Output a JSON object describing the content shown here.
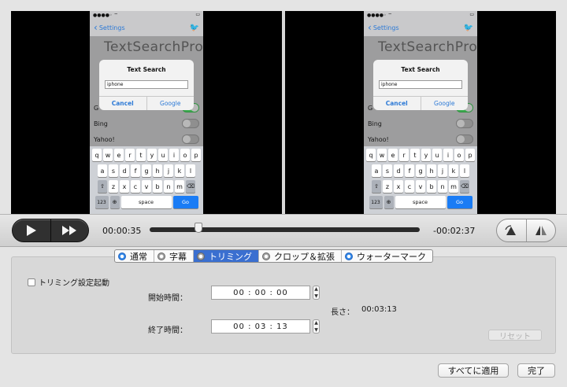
{
  "phone": {
    "nav_back": "Settings",
    "app_title": "TextSearchPro",
    "alert_title": "Text Search",
    "alert_input_value": "iphone",
    "alert_cancel": "Cancel",
    "alert_google": "Google",
    "row_g": "G",
    "row_bing": "Bing",
    "row_yahoo": "Yahoo!",
    "keys_row1": [
      "q",
      "w",
      "e",
      "r",
      "t",
      "y",
      "u",
      "i",
      "o",
      "p"
    ],
    "keys_row2": [
      "a",
      "s",
      "d",
      "f",
      "g",
      "h",
      "j",
      "k",
      "l"
    ],
    "keys_row3": [
      "z",
      "x",
      "c",
      "v",
      "b",
      "n",
      "m"
    ],
    "key_num": "123",
    "key_space": "space",
    "key_go": "Go"
  },
  "transport": {
    "current_time": "00:00:35",
    "remaining_time": "-00:02:37",
    "playback_position": 0.18
  },
  "tabs": [
    {
      "label": "通常",
      "state": "blue"
    },
    {
      "label": "字幕",
      "state": "gray"
    },
    {
      "label": "トリミング",
      "state": "active"
    },
    {
      "label": "クロップ＆拡張",
      "state": "gray"
    },
    {
      "label": "ウォーターマーク",
      "state": "blue"
    }
  ],
  "trim": {
    "enable_label": "トリミング設定起動",
    "start_label": "開始時間：",
    "start_value": "00 : 00 : 00",
    "end_label": "終了時間：",
    "end_value": "00 : 03 : 13",
    "length_label": "長さ：",
    "length_value": "00:03:13",
    "reset_label": "リセット"
  },
  "footer": {
    "apply_all_label": "すべてに適用",
    "done_label": "完了"
  }
}
